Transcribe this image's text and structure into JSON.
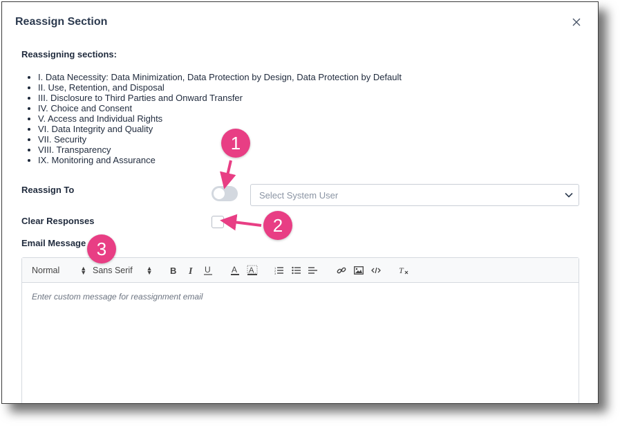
{
  "modal": {
    "title": "Reassign Section",
    "close_icon": "close-icon"
  },
  "sections_heading": "Reassigning sections:",
  "sections": [
    "I. Data Necessity: Data Minimization, Data Protection by Design, Data Protection by Default",
    "II. Use, Retention, and Disposal",
    "III. Disclosure to Third Parties and Onward Transfer",
    "IV. Choice and Consent",
    "V. Access and Individual Rights",
    "VI. Data Integrity and Quality",
    "VII. Security",
    "VIII. Transparency",
    "IX. Monitoring and Assurance"
  ],
  "reassign_to": {
    "label": "Reassign To",
    "toggle_on": false,
    "select_placeholder": "Select System User"
  },
  "clear_responses": {
    "label": "Clear Responses",
    "checked": false
  },
  "email_message": {
    "label": "Email Message",
    "toolbar": {
      "heading_select": "Normal",
      "font_select": "Sans Serif",
      "buttons": [
        "bold-icon",
        "italic-icon",
        "underline-icon",
        "text-color-icon",
        "background-color-icon",
        "ordered-list-icon",
        "bullet-list-icon",
        "align-icon",
        "link-icon",
        "image-icon",
        "code-icon",
        "clear-format-icon"
      ]
    },
    "placeholder": "Enter custom message for reassignment email"
  },
  "annotations": [
    "1",
    "2",
    "3"
  ],
  "colors": {
    "annotation": "#e83e84",
    "title": "#2c3a4f",
    "toggle_off": "#d3d8df"
  }
}
